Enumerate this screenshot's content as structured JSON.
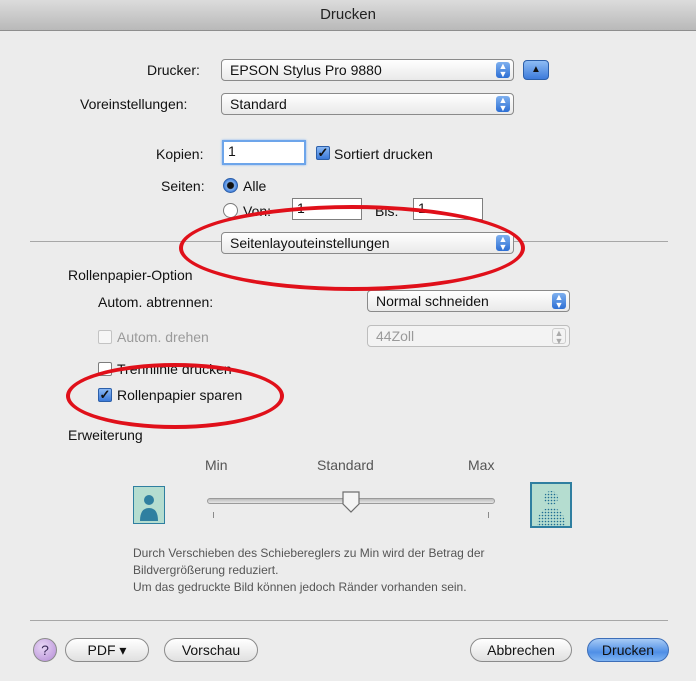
{
  "window": {
    "title": "Drucken"
  },
  "printer": {
    "label": "Drucker:",
    "value": "EPSON Stylus Pro 9880"
  },
  "presets": {
    "label": "Voreinstellungen:",
    "value": "Standard"
  },
  "copies": {
    "label": "Kopien:",
    "value": "1",
    "collate_label": "Sortiert drucken",
    "collate_checked": true
  },
  "pages": {
    "label": "Seiten:",
    "all_label": "Alle",
    "from_label": "Von:",
    "from_value": "1",
    "to_label": "Bis:",
    "to_value": "1"
  },
  "panel_select": {
    "value": "Seitenlayouteinstellungen"
  },
  "roll": {
    "section_title": "Rollenpapier-Option",
    "auto_cut_label": "Autom. abtrennen:",
    "auto_cut_value": "Normal schneiden",
    "auto_rotate_label": "Autom. drehen",
    "auto_rotate_value": "44Zoll",
    "cut_line_label": "Trennlinie drucken",
    "save_roll_label": "Rollenpapier sparen",
    "save_roll_checked": true
  },
  "expansion": {
    "section_title": "Erweiterung",
    "min_label": "Min",
    "standard_label": "Standard",
    "max_label": "Max",
    "slider_value": "Standard",
    "note_line1": "Durch Verschieben des Schiebereglers zu Min wird der Betrag der",
    "note_line2": "Bildvergrößerung reduziert.",
    "note_line3": "Um das gedruckte Bild können jedoch Ränder vorhanden sein."
  },
  "footer": {
    "help_label": "?",
    "pdf_label": "PDF ▾",
    "preview_label": "Vorschau",
    "cancel_label": "Abbrechen",
    "print_label": "Drucken"
  },
  "colors": {
    "highlight": "#e0101a",
    "accent": "#3a79d9"
  },
  "icons": {
    "popup_arrow": "up-down-arrows-icon",
    "collapse": "disclosure-up-icon",
    "person_small": "person-small-icon",
    "person_large": "person-large-icon"
  }
}
